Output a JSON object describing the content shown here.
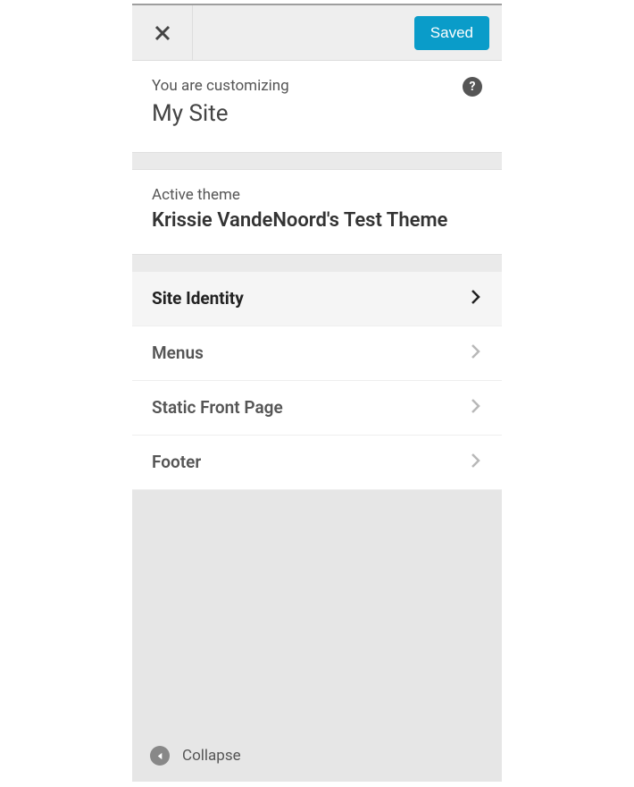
{
  "topbar": {
    "saved_label": "Saved"
  },
  "intro": {
    "prefix": "You are customizing",
    "site_name": "My Site"
  },
  "theme": {
    "label": "Active theme",
    "name": "Krissie VandeNoord's Test Theme"
  },
  "sections": [
    {
      "label": "Site Identity",
      "active": true
    },
    {
      "label": "Menus",
      "active": false
    },
    {
      "label": "Static Front Page",
      "active": false
    },
    {
      "label": "Footer",
      "active": false
    }
  ],
  "footer": {
    "collapse_label": "Collapse"
  }
}
